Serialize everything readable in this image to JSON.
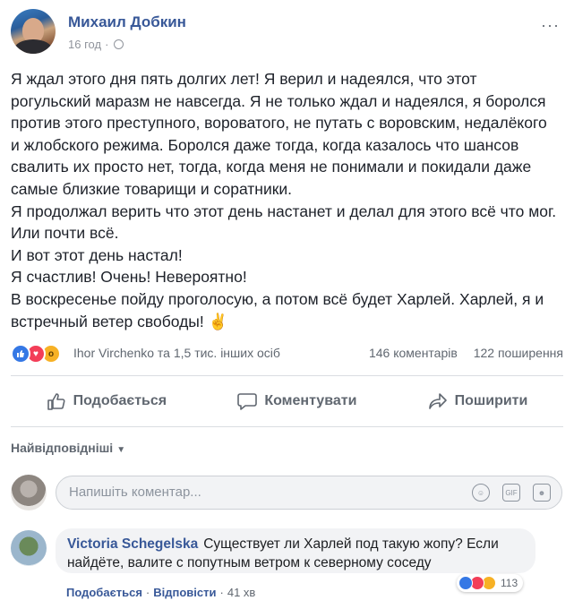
{
  "post": {
    "author": "Михаил Добкин",
    "time": "16 год",
    "time_sep": "·",
    "more": "···",
    "paragraphs": [
      "Я ждал этого дня пять долгих лет! Я верил и надеялся, что этот рогульский маразм не навсегда. Я не только ждал и надеялся, я боролся против этого преступного, вороватого, не путать с воровским, недалёкого и жлобского режима. Боролся даже тогда, когда казалось что шансов свалить их просто нет, тогда, когда меня не понимали и покидали даже самые близкие товарищи и соратники.",
      "Я продолжал верить что этот день настанет и делал для этого всё что мог. Или почти всё.",
      "И вот этот день настал!",
      "Я счастлив! Очень! Невероятно!",
      "В воскресенье пойду проголосую, а потом всё будет Харлей. Харлей, я и встречный ветер свободы! ✌"
    ]
  },
  "reactions": {
    "icons": [
      "like",
      "love",
      "wow"
    ],
    "names": "Ihor Virchenko та 1,5 тис. інших осіб",
    "comments": "146 коментарів",
    "shares": "122 поширення"
  },
  "actions": {
    "like": "Подобається",
    "comment": "Коментувати",
    "share": "Поширити"
  },
  "sort": {
    "label": "Найвідповідніші"
  },
  "composer": {
    "placeholder": "Напишіть коментар..."
  },
  "comment": {
    "author": "Victoria Schegelska",
    "text": "Существует ли Харлей под такую жопу? Если найдёте, валите с попутным ветром к северному соседу",
    "like_label": "Подобається",
    "reply_label": "Відповісти",
    "time": "41 хв",
    "sep": "·",
    "reaction_count": "113"
  },
  "colors": {
    "link": "#385898",
    "like_blue": "#3578e5",
    "love_red": "#f33e58",
    "wow_yellow": "#f7b125"
  }
}
